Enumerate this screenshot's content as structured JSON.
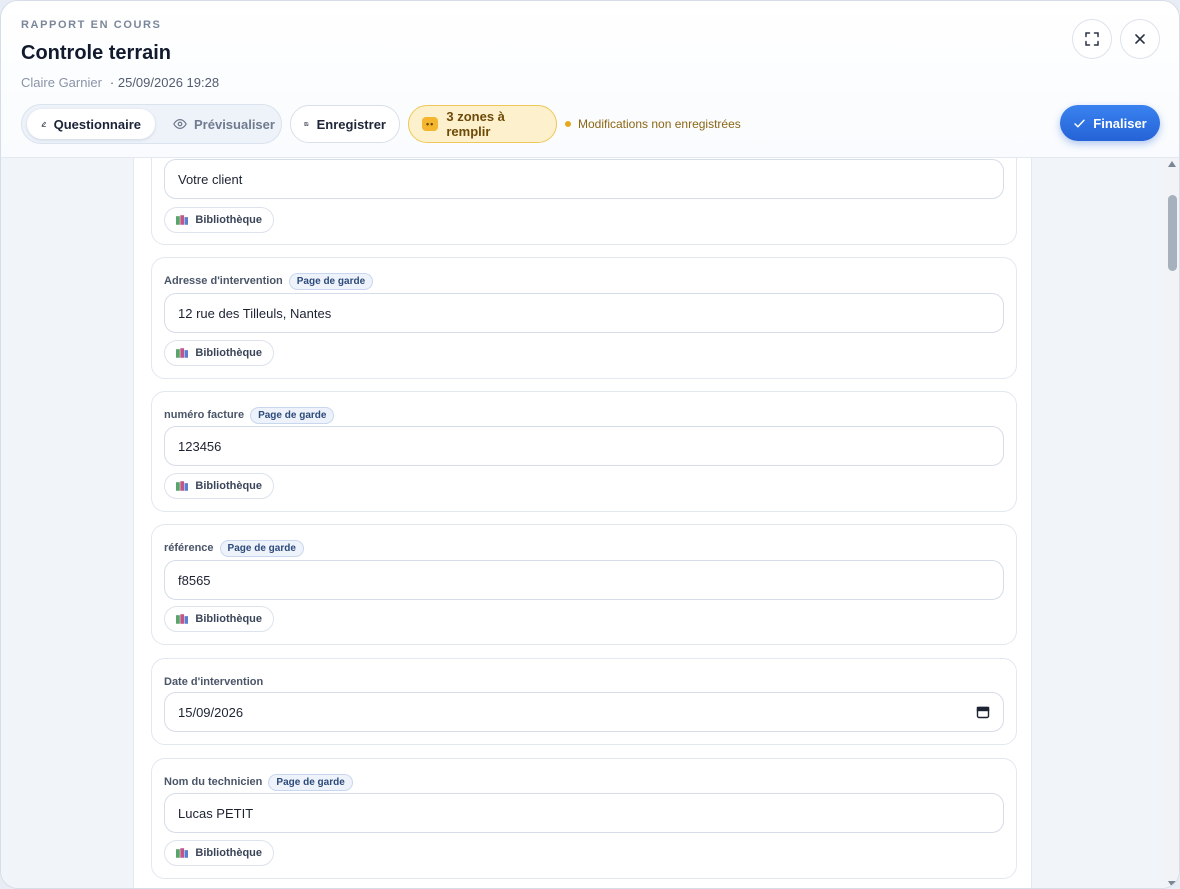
{
  "header": {
    "eyebrow": "RAPPORT EN COURS",
    "title": "Controle terrain",
    "author": "Claire Garnier",
    "datetime": "· 25/09/2026 19:28"
  },
  "toolbar": {
    "tab_questionnaire": "Questionnaire",
    "tab_preview": "Prévisualiser",
    "save_label": "Enregistrer",
    "zones_label": "3 zones à remplir",
    "zones_icon_glyph": "••",
    "unsaved_label": "Modifications non enregistrées",
    "finalize_label": "Finaliser"
  },
  "library_label": "Bibliothèque",
  "fields": [
    {
      "label": "",
      "badge": "",
      "value": "Votre client"
    },
    {
      "label": "Adresse d'intervention",
      "badge": "Page de garde",
      "value": "12 rue des Tilleuls, Nantes"
    },
    {
      "label": "numéro facture",
      "badge": "Page de garde",
      "value": "123456"
    },
    {
      "label": "référence",
      "badge": "Page de garde",
      "value": "f8565"
    },
    {
      "label": "Date d'intervention",
      "badge": "",
      "value": "15/09/2026"
    },
    {
      "label": "Nom du technicien",
      "badge": "Page de garde",
      "value": "Lucas PETIT"
    }
  ],
  "colors": {
    "accent": "#2563d6",
    "warning_bg": "#fdf1cd",
    "warning_border": "#efc658",
    "warning_dot": "#e6a91c"
  }
}
